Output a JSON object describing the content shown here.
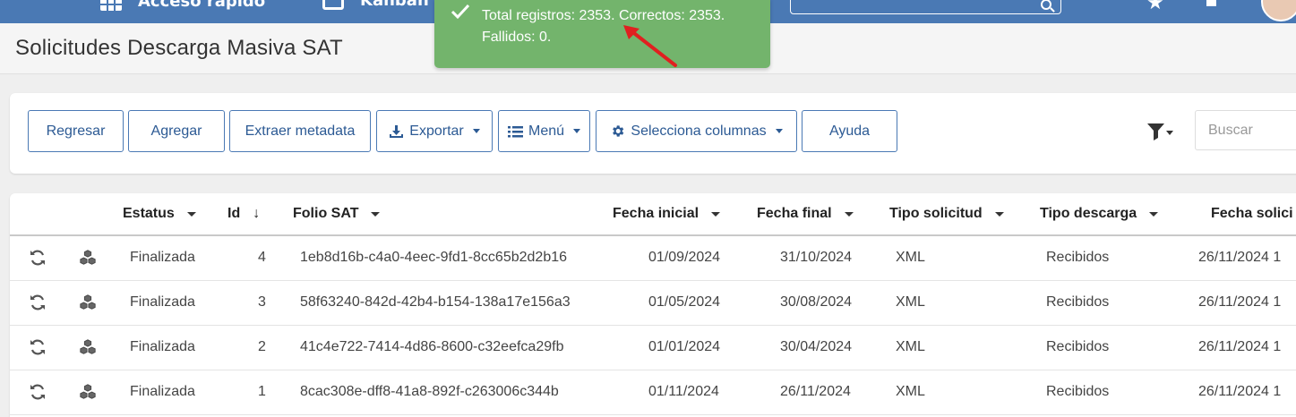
{
  "topbar": {
    "item1_label": "Acceso rápido",
    "item2_label": "Kanban",
    "search_value": ""
  },
  "toast": {
    "message": "Total registros: 2353. Correctos: 2353. Fallidos: 0."
  },
  "page": {
    "title": "Solicitudes Descarga Masiva SAT"
  },
  "toolbar": {
    "back_label": "Regresar",
    "add_label": "Agregar",
    "extract_label": "Extraer metadata",
    "export_label": "Exportar",
    "menu_label": "Menú",
    "columns_label": "Selecciona columnas",
    "help_label": "Ayuda",
    "search_placeholder": "Buscar"
  },
  "table": {
    "headers": {
      "estatus": "Estatus",
      "id": "Id",
      "folio": "Folio SAT",
      "fecha_inicial": "Fecha inicial",
      "fecha_final": "Fecha final",
      "tipo_solicitud": "Tipo solicitud",
      "tipo_descarga": "Tipo descarga",
      "fecha_solicitud": "Fecha solici"
    },
    "rows": [
      {
        "estatus": "Finalizada",
        "id": "4",
        "folio": "1eb8d16b-c4a0-4eec-9fd1-8cc65b2d2b16",
        "fecha_inicial": "01/09/2024",
        "fecha_final": "31/10/2024",
        "tipo_solicitud": "XML",
        "tipo_descarga": "Recibidos",
        "fecha_solicitud": "26/11/2024 1"
      },
      {
        "estatus": "Finalizada",
        "id": "3",
        "folio": "58f63240-842d-42b4-b154-138a17e156a3",
        "fecha_inicial": "01/05/2024",
        "fecha_final": "30/08/2024",
        "tipo_solicitud": "XML",
        "tipo_descarga": "Recibidos",
        "fecha_solicitud": "26/11/2024 1"
      },
      {
        "estatus": "Finalizada",
        "id": "2",
        "folio": "41c4e722-7414-4d86-8600-c32eefca29fb",
        "fecha_inicial": "01/01/2024",
        "fecha_final": "30/04/2024",
        "tipo_solicitud": "XML",
        "tipo_descarga": "Recibidos",
        "fecha_solicitud": "26/11/2024 1"
      },
      {
        "estatus": "Finalizada",
        "id": "1",
        "folio": "8cac308e-dff8-41a8-892f-c263006c344b",
        "fecha_inicial": "01/11/2024",
        "fecha_final": "26/11/2024",
        "tipo_solicitud": "XML",
        "tipo_descarga": "Recibidos",
        "fecha_solicitud": "26/11/2024 1"
      }
    ]
  },
  "colors": {
    "navbar": "#4a79b4",
    "toast": "#73b46c",
    "button_border": "#4a79b4",
    "button_text": "#2c5a94",
    "annotation_arrow": "#e02020"
  },
  "icons": [
    "check-icon",
    "download-icon",
    "list-icon",
    "gear-icon",
    "filter-icon",
    "refresh-icon",
    "cubes-icon",
    "search-icon",
    "star-icon"
  ]
}
